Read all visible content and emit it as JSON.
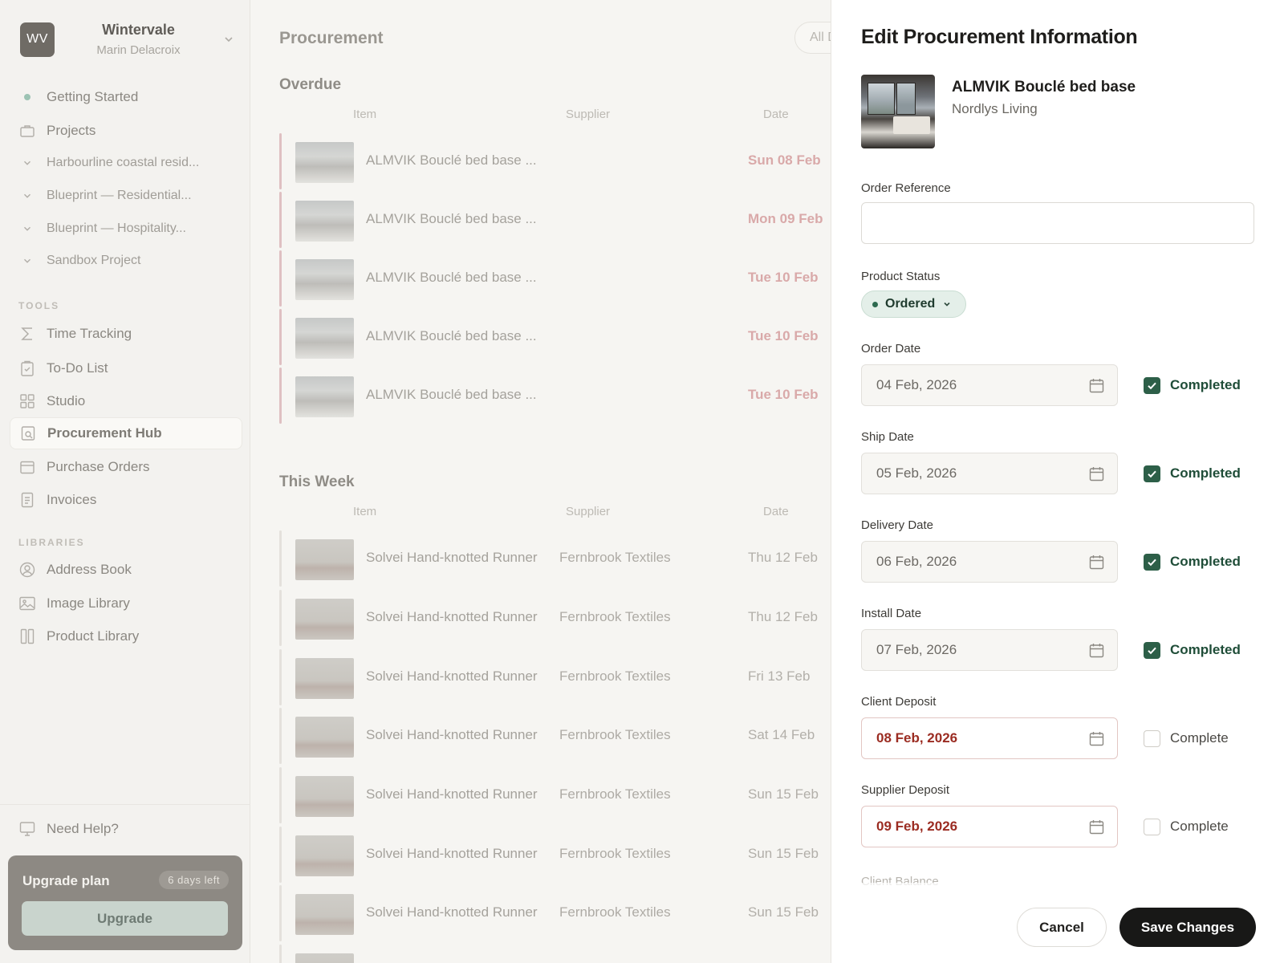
{
  "workspace": {
    "initials": "WV",
    "name": "Wintervale",
    "user": "Marin Delacroix"
  },
  "sidebar": {
    "getting_started": "Getting Started",
    "projects": "Projects",
    "project_items": [
      "Harbourline coastal resid...",
      "Blueprint — Residential...",
      "Blueprint — Hospitality...",
      "Sandbox Project"
    ],
    "tools_heading": "TOOLS",
    "tools": [
      "Time Tracking",
      "To-Do List",
      "Studio",
      "Procurement Hub",
      "Purchase Orders",
      "Invoices"
    ],
    "libraries_heading": "LIBRARIES",
    "libraries": [
      "Address Book",
      "Image Library",
      "Product Library"
    ],
    "help": "Need Help?",
    "upgrade": {
      "title": "Upgrade plan",
      "badge": "6 days left",
      "button": "Upgrade"
    }
  },
  "main": {
    "title": "Procurement",
    "filter": "All D",
    "columns": {
      "item": "Item",
      "supplier": "Supplier",
      "date": "Date"
    },
    "overdue": {
      "title": "Overdue",
      "rows": [
        {
          "item": "ALMVIK Bouclé bed base ...",
          "supplier": "",
          "date": "Sun 08 Feb"
        },
        {
          "item": "ALMVIK Bouclé bed base ...",
          "supplier": "",
          "date": "Mon 09 Feb"
        },
        {
          "item": "ALMVIK Bouclé bed base ...",
          "supplier": "",
          "date": "Tue 10 Feb"
        },
        {
          "item": "ALMVIK Bouclé bed base ...",
          "supplier": "",
          "date": "Tue 10 Feb"
        },
        {
          "item": "ALMVIK Bouclé bed base ...",
          "supplier": "",
          "date": "Tue 10 Feb"
        }
      ]
    },
    "this_week": {
      "title": "This Week",
      "rows": [
        {
          "item": "Solvei Hand-knotted Runner",
          "supplier": "Fernbrook Textiles",
          "date": "Thu 12 Feb"
        },
        {
          "item": "Solvei Hand-knotted Runner",
          "supplier": "Fernbrook Textiles",
          "date": "Thu 12 Feb"
        },
        {
          "item": "Solvei Hand-knotted Runner",
          "supplier": "Fernbrook Textiles",
          "date": "Fri 13 Feb"
        },
        {
          "item": "Solvei Hand-knotted Runner",
          "supplier": "Fernbrook Textiles",
          "date": "Sat 14 Feb"
        },
        {
          "item": "Solvei Hand-knotted Runner",
          "supplier": "Fernbrook Textiles",
          "date": "Sun 15 Feb"
        },
        {
          "item": "Solvei Hand-knotted Runner",
          "supplier": "Fernbrook Textiles",
          "date": "Sun 15 Feb"
        },
        {
          "item": "Solvei Hand-knotted Runner",
          "supplier": "Fernbrook Textiles",
          "date": "Sun 15 Feb"
        }
      ]
    }
  },
  "panel": {
    "title": "Edit Procurement Information",
    "product": {
      "name": "ALMVIK Bouclé bed base",
      "supplier": "Nordlys Living"
    },
    "order_reference": {
      "label": "Order Reference",
      "value": ""
    },
    "product_status": {
      "label": "Product Status",
      "value": "Ordered"
    },
    "dates": [
      {
        "label": "Order Date",
        "value": "04 Feb, 2026",
        "check_label": "Completed",
        "checked": true
      },
      {
        "label": "Ship Date",
        "value": "05 Feb, 2026",
        "check_label": "Completed",
        "checked": true
      },
      {
        "label": "Delivery Date",
        "value": "06 Feb, 2026",
        "check_label": "Completed",
        "checked": true
      },
      {
        "label": "Install Date",
        "value": "07 Feb, 2026",
        "check_label": "Completed",
        "checked": true
      },
      {
        "label": "Client Deposit",
        "value": "08 Feb, 2026",
        "check_label": "Complete",
        "checked": false
      },
      {
        "label": "Supplier Deposit",
        "value": "09 Feb, 2026",
        "check_label": "Complete",
        "checked": false
      }
    ],
    "next_label": "Client Balance",
    "cancel": "Cancel",
    "save": "Save Changes"
  },
  "colors": {
    "accent_green": "#2d5f48",
    "overdue_red": "#9b2c22",
    "primary_button": "#181817"
  }
}
